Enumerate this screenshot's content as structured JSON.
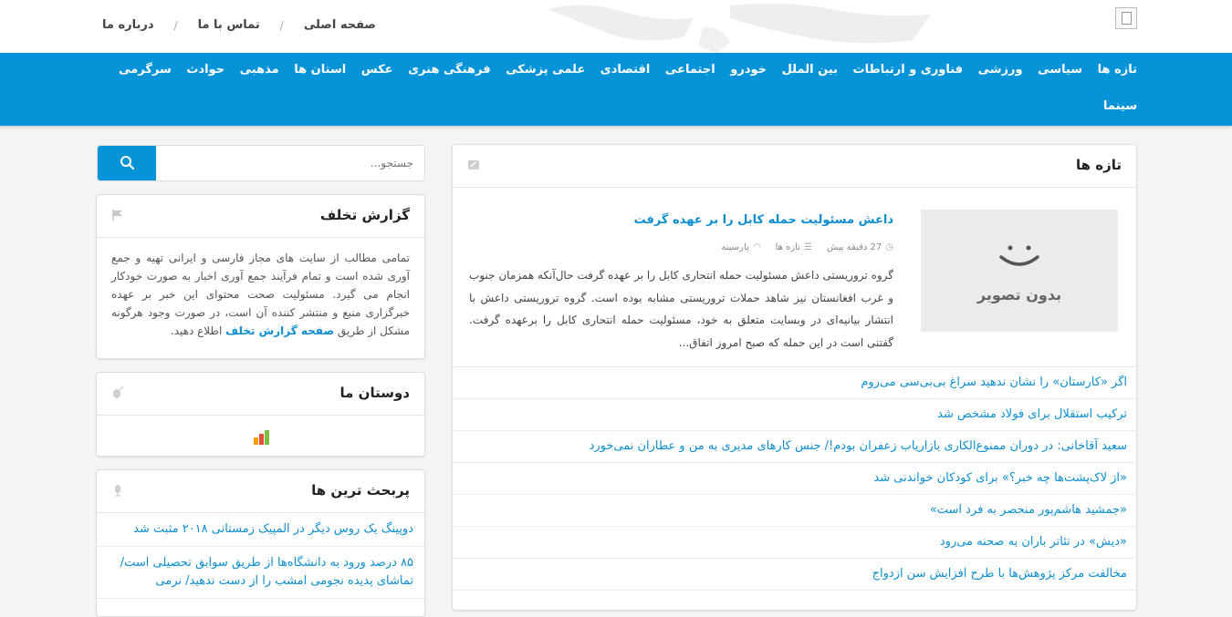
{
  "top_links": [
    {
      "label": "صفحه اصلی"
    },
    {
      "label": "تماس با ما"
    },
    {
      "label": "درباره ما"
    }
  ],
  "nav": {
    "row1": [
      "تازه ها",
      "سیاسی",
      "ورزشی",
      "فناوری و ارتباطات",
      "بین الملل",
      "خودرو",
      "اجتماعی",
      "اقتصادی",
      "علمی پزشکی",
      "فرهنگی هنری",
      "عکس",
      "استان ها",
      "مذهبی",
      "حوادث",
      "سرگرمی"
    ],
    "row2": [
      "سینما"
    ]
  },
  "main": {
    "title": "تازه ها",
    "featured": {
      "image_placeholder": "بدون تصویر",
      "headline": "داعش مسئولیت حمله کابل را بر عهده گرفت",
      "time": "27 دقیقه پیش",
      "category": "تازه ها",
      "source": "پارسینه",
      "summary": "گروه تروریستی داعش مسئولیت حمله انتحاری کابل را بر عهده گرفت حال‌آنکه همزمان جنوب و غرب افغانستان نیز شاهد حملات تروریستی مشابه بوده است. گروه تروریستی داعش با انتشار بیانیه‌ای در وبسایت متعلق به خود، مسئولیت حمله انتحاری کابل را برعهده گرفت. گفتنی است در این حمله که صبح امروز اتفاق..."
    },
    "news": [
      "اگر «کارستان» را نشان ندهید سراغ بی‌بی‌سی می‌روم",
      "ترکیب استقلال برای فولاد مشخص شد",
      "سعید آقاخانی: در دوران ممنوع‌الکاری بازاریاب زعفران بودم!/ جنس کارهای مدیری به من و عطاران نمی‌خورد",
      "«از لاک‌پشت‌ها چه خبر؟» برای کودکان خواندنی شد",
      "«جمشید هاشم‌پور منحصر به فرد است»",
      "«دیش» در تئاتر باران به صحنه می‌رود",
      "مخالفت مرکز پژوهش‌ها با طرح افزایش سن ازدواج"
    ]
  },
  "search": {
    "placeholder": "جستجو..."
  },
  "report": {
    "title": "گزارش تخلف",
    "text_before": "تمامی مطالب از سایت های مجاز فارسی و ایرانی تهیه و جمع آوری شده است و تمام فرآیند جمع آوری اخبار به صورت خودکار انجام می گیرد. مسئولیت صحت محتوای این خبر بر عهده خبرگزاری منبع و منتشر کننده آن است، در صورت وجود هرگونه مشکل از طریق",
    "link": "صفحه گزارش تخلف",
    "text_after": "اطلاع دهید."
  },
  "friends": {
    "title": "دوستان ما"
  },
  "popular": {
    "title": "پربحث ترین ها",
    "items": [
      "دوپینگ یک روس دیگر در المپیک زمستانی ۲۰۱۸ مثبت شد",
      "۸۵ درصد ورود به دانشگاه‌ها از طریق سوابق تحصیلی است/ تماشای پدیده نجومی امشب را از دست ندهید/ نرمی"
    ]
  },
  "colors": {
    "accent": "#0693d8",
    "link": "#0c8ed0"
  }
}
